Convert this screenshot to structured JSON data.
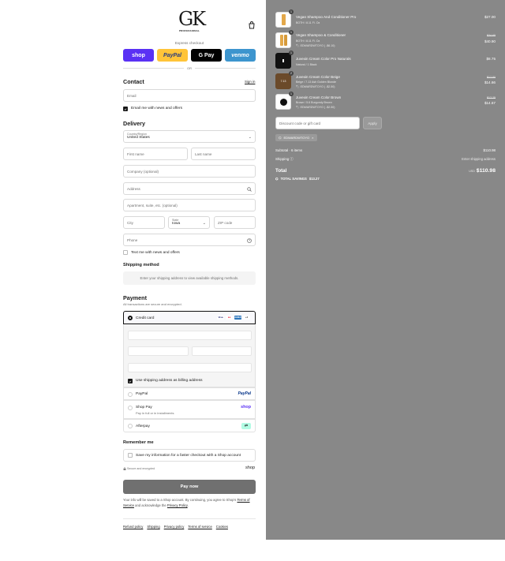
{
  "header": {
    "logo_text": "GK",
    "logo_sub": "PROFESSIONAL",
    "cart_icon": "shopping-bag-icon"
  },
  "express": {
    "title": "Express checkout",
    "shop": "shop",
    "paypal": "PayPal",
    "gpay": "G Pay",
    "venmo": "venmo",
    "or": "OR",
    "colors": {
      "shop": "#5a31f4",
      "paypal": "#ffc439",
      "gpay": "#000000",
      "venmo": "#3d95ce"
    }
  },
  "contact": {
    "title": "Contact",
    "signin": "Sign in",
    "email_placeholder": "Email",
    "news_label": "Email me with news and offers"
  },
  "delivery": {
    "title": "Delivery",
    "country_label": "Country/Region",
    "country_value": "United States",
    "first_name": "First name",
    "last_name": "Last name",
    "company": "Company (optional)",
    "address": "Address",
    "apartment": "Apartment, suite, etc. (optional)",
    "city": "City",
    "state_label": "State",
    "state_value": "Iowa",
    "zip": "ZIP code",
    "phone": "Phone",
    "text_label": "Text me with news and offers"
  },
  "shipping": {
    "title": "Shipping method",
    "message": "Enter your shipping address to view available shipping methods."
  },
  "payment": {
    "title": "Payment",
    "subtitle": "All transactions are secure and encrypted.",
    "credit_card": "Credit card",
    "cards": [
      "Visa",
      "MC",
      "AMEX",
      "+4"
    ],
    "billing_label": "Use shipping address as billing address",
    "paypal": "PayPal",
    "paypal_logo": "PayPal",
    "shoppay": "Shop Pay",
    "shoppay_sub": "Pay in full or in installments",
    "shoppay_logo": "shop",
    "afterpay": "Afterpay"
  },
  "remember": {
    "title": "Remember me",
    "label": "Save my information for a faster checkout with a Shop account",
    "secure": "Secure and encrypted",
    "shop_logo": "shop"
  },
  "pay_button": "Pay now",
  "legal": {
    "pre": "Your info will be saved to a Shop account. By continuing, you agree to Shop's",
    "tos": "Terms of Service",
    "mid": "and acknowledge the",
    "privacy": "Privacy Policy",
    "end": "."
  },
  "footer": [
    "Refund policy",
    "Shipping",
    "Privacy policy",
    "Terms of service",
    "Cookies"
  ],
  "cart": {
    "items": [
      {
        "qty": "1",
        "name": "Vegan Shampoo And Conditioner Pro",
        "variant": "BOTH / 8.11 Fl. Oz",
        "discount": "",
        "old_price": "",
        "price": "$27.00"
      },
      {
        "qty": "1",
        "name": "Vegan Shampoo & Conditioner",
        "variant": "BOTH / 8.11 Fl. Oz",
        "discount": "EDWARDWTOYO ( -$6.10)",
        "old_price": "$34.65",
        "price": "$40.90"
      },
      {
        "qty": "1",
        "name": "Juvexin Cream Color Pro Naturals",
        "variant": "Natural / 1 Black",
        "discount": "",
        "old_price": "",
        "price": "$8.75"
      },
      {
        "qty": "2",
        "name": "Juvexin Cream Color Beige",
        "variant": "Beige / 7.13 Ash Golden Blonde",
        "discount": "EDWARDWTOYO ( -$2.50)",
        "old_price": "$17.50",
        "price": "$14.66"
      },
      {
        "qty": "1",
        "name": "Juvexin Cream Color Brown",
        "variant": "Brown / 5.6 Burgundy Brown",
        "discount": "EDWARDWTOYO ( -$2.50)",
        "old_price": "$17.25",
        "price": "$14.67"
      }
    ],
    "discount_placeholder": "Discount code or gift card",
    "apply": "Apply",
    "code_tag": "EDWARDWTOYO",
    "subtotal_label": "Subtotal · 6 items",
    "subtotal": "$110.98",
    "shipping_label": "Shipping",
    "shipping_value": "Enter shipping address",
    "total_label": "Total",
    "currency": "USD",
    "total": "$110.98",
    "savings_label": "TOTAL SAVINGS",
    "savings": "$13.27"
  }
}
